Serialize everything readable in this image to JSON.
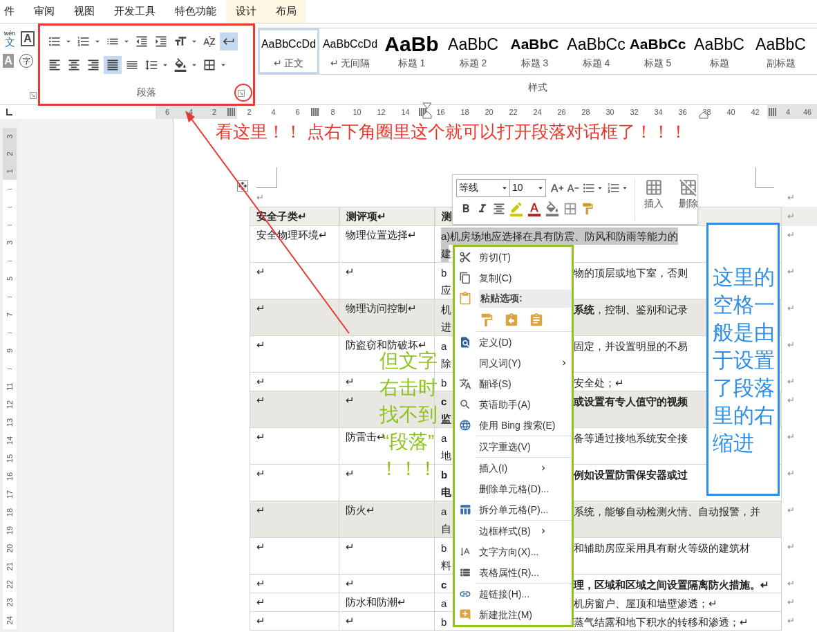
{
  "ribbon_tabs": [
    {
      "label": "件",
      "contextual": false
    },
    {
      "label": "审阅",
      "contextual": false
    },
    {
      "label": "视图",
      "contextual": false
    },
    {
      "label": "开发工具",
      "contextual": false
    },
    {
      "label": "特色功能",
      "contextual": false
    },
    {
      "label": "设计",
      "contextual": true
    },
    {
      "label": "布局",
      "contextual": true
    }
  ],
  "font_group": {
    "phonetic_top": "wén",
    "phonetic_char": "文",
    "border_char": "A",
    "shading_char": "A",
    "enclose_char": "字"
  },
  "paragraph_group": {
    "label": "段落",
    "row_1": [
      {
        "dropdown": true,
        "selected": false
      },
      {
        "dropdown": true,
        "selected": false
      },
      {
        "dropdown": true,
        "selected": false
      },
      {
        "dropdown": false,
        "selected": false
      },
      {
        "dropdown": false,
        "selected": false
      },
      {
        "dropdown": true,
        "selected": false
      },
      {
        "dropdown": false,
        "selected": false
      },
      {
        "dropdown": false,
        "selected": true
      }
    ],
    "row_2": [
      {
        "dropdown": false,
        "selected": false
      },
      {
        "dropdown": false,
        "selected": false
      },
      {
        "dropdown": false,
        "selected": false
      },
      {
        "dropdown": false,
        "selected": true
      },
      {
        "dropdown": false,
        "selected": false
      },
      {
        "dropdown": true,
        "selected": false
      },
      {
        "dropdown": true,
        "selected": false
      },
      {
        "dropdown": true,
        "selected": false
      }
    ]
  },
  "styles_group": {
    "label": "样式",
    "styles": [
      {
        "preview": "AaBbCcDd",
        "name": "↵ 正文",
        "kind": "small",
        "selected": true
      },
      {
        "preview": "AaBbCcDd",
        "name": "↵ 无间隔",
        "kind": "small",
        "selected": false
      },
      {
        "preview": "AaBb",
        "name": "标题 1",
        "kind": "large_bold",
        "selected": false
      },
      {
        "preview": "AaBbC",
        "name": "标题 2",
        "kind": "medium",
        "selected": false
      },
      {
        "preview": "AaBbC",
        "name": "标题 3",
        "kind": "medium_bold",
        "selected": false
      },
      {
        "preview": "AaBbCc",
        "name": "标题 4",
        "kind": "medium",
        "selected": false
      },
      {
        "preview": "AaBbCc",
        "name": "标题 5",
        "kind": "medium_bold",
        "selected": false
      },
      {
        "preview": "AaBbC",
        "name": "标题",
        "kind": "medium",
        "selected": false
      },
      {
        "preview": "AaBbC",
        "name": "副标题",
        "kind": "medium",
        "selected": false
      }
    ]
  },
  "horizontal_ruler": {
    "left_margin": [
      {
        "kind": "number",
        "text": "6"
      },
      {
        "kind": "number",
        "text": "4"
      },
      {
        "kind": "number",
        "text": "2"
      },
      {
        "kind": "column"
      }
    ],
    "body": [
      {
        "kind": "number",
        "text": "2"
      },
      {
        "kind": "number",
        "text": "4"
      },
      {
        "kind": "number",
        "text": "6"
      },
      {
        "kind": "column"
      },
      {
        "kind": "number",
        "text": "8"
      },
      {
        "kind": "number",
        "text": "10"
      },
      {
        "kind": "number",
        "text": "12"
      },
      {
        "kind": "number",
        "text": "14"
      },
      {
        "kind": "column"
      },
      {
        "kind": "number",
        "text": "16"
      },
      {
        "kind": "number",
        "text": "18"
      },
      {
        "kind": "number",
        "text": "20"
      },
      {
        "kind": "number",
        "text": "22"
      },
      {
        "kind": "number",
        "text": "24"
      },
      {
        "kind": "number",
        "text": "26"
      },
      {
        "kind": "number",
        "text": "28"
      },
      {
        "kind": "number",
        "text": "30"
      },
      {
        "kind": "number",
        "text": "32"
      },
      {
        "kind": "number",
        "text": "34"
      },
      {
        "kind": "number",
        "text": "36"
      },
      {
        "kind": "number",
        "text": "38"
      },
      {
        "kind": "number",
        "text": "40"
      },
      {
        "kind": "number",
        "text": "42"
      }
    ],
    "right_margin": [
      {
        "kind": "column"
      },
      {
        "kind": "number",
        "text": "4"
      },
      {
        "kind": "number",
        "text": "46"
      }
    ]
  },
  "vertical_ruler": {
    "top": [
      {
        "kind": "number",
        "text": "3"
      },
      {
        "kind": "number",
        "text": "2"
      },
      {
        "kind": "number",
        "text": "1"
      }
    ],
    "body": [
      {
        "kind": "tick"
      },
      {
        "kind": "tick"
      },
      {
        "kind": "tick"
      },
      {
        "kind": "number",
        "text": "3"
      },
      {
        "kind": "tick"
      },
      {
        "kind": "number",
        "text": "5"
      },
      {
        "kind": "tick"
      },
      {
        "kind": "number",
        "text": "7"
      },
      {
        "kind": "tick"
      },
      {
        "kind": "number",
        "text": "9"
      },
      {
        "kind": "tick"
      },
      {
        "kind": "number",
        "text": "11"
      },
      {
        "kind": "number",
        "text": "12"
      },
      {
        "kind": "number",
        "text": "13"
      },
      {
        "kind": "number",
        "text": "14"
      },
      {
        "kind": "number",
        "text": "15"
      },
      {
        "kind": "number",
        "text": "16"
      },
      {
        "kind": "number",
        "text": "17"
      },
      {
        "kind": "number",
        "text": "18"
      },
      {
        "kind": "number",
        "text": "19"
      },
      {
        "kind": "number",
        "text": "20"
      },
      {
        "kind": "number",
        "text": "21"
      },
      {
        "kind": "number",
        "text": "22"
      },
      {
        "kind": "number",
        "text": "23"
      },
      {
        "kind": "number",
        "text": "24"
      }
    ]
  },
  "document": {
    "top_marks": [
      "↵",
      "↵"
    ],
    "table": {
      "header": [
        "安全子类↵",
        "测评项↵",
        "测"
      ],
      "header_end": "↵",
      "rows": [
        {
          "col_1": "安全物理环境↵",
          "col_2": "物理位置选择↵",
          "col_3": {
            "left": "a)机房场地应选择在具有防震、防风和防雨等能力的",
            "line_2": "建",
            "selected": true,
            "bold": false
          },
          "shaded": false,
          "end": "↵"
        },
        {
          "col_1": "↵",
          "col_2": "↵",
          "col_3": {
            "left": "b",
            "right": "物的顶层或地下室，否则",
            "line_2": "应",
            "selected": false,
            "bold": false
          },
          "shaded": false,
          "end": "↵"
        },
        {
          "col_1": "↵",
          "col_2": "物理访问控制↵",
          "col_3": {
            "left": "机",
            "right": "**系统**，控制、鉴别和记录",
            "line_2": "进",
            "selected": false,
            "bold": false
          },
          "shaded": true,
          "end": "↵"
        },
        {
          "col_1": "↵",
          "col_2": "防盗窃和防破坏↵",
          "col_3": {
            "left": "a",
            "right": "固定，并设置明显的不易",
            "line_2": "除",
            "selected": false,
            "bold": false
          },
          "shaded": false,
          "end": "↵"
        },
        {
          "col_1": "↵",
          "col_2": "↵",
          "col_3": {
            "left": "b",
            "right": "安全处；↵",
            "selected": false,
            "bold": false
          },
          "shaded": false,
          "end": "↵"
        },
        {
          "col_1": "↵",
          "col_2": "↵",
          "col_3": {
            "left": "c",
            "right": "或设置有专人值守的视频",
            "line_2": "监",
            "selected": false,
            "bold": true
          },
          "shaded": true,
          "end": "↵"
        },
        {
          "col_1": "↵",
          "col_2": "防雷击↵",
          "col_3": {
            "left": "a",
            "right": "备等通过接地系统安全接",
            "line_2": "地",
            "selected": false,
            "bold": false
          },
          "shaded": false,
          "end": "↵"
        },
        {
          "col_1": "↵",
          "col_2": "↵",
          "col_3": {
            "left": "b",
            "right": "例如设置防雷保安器或过",
            "line_2": "电",
            "selected": false,
            "bold": true
          },
          "shaded": false,
          "end": "↵"
        },
        {
          "col_1": "↵",
          "col_2": "防火↵",
          "col_3": {
            "left": "a",
            "right": "系统，能够自动检测火情、自动报警，并",
            "line_2": "自",
            "selected": false,
            "bold": false
          },
          "shaded": true,
          "end": "↵"
        },
        {
          "col_1": "↵",
          "col_2": "↵",
          "col_3": {
            "left": "b",
            "right": "和辅助房应采用具有耐火等级的建筑材",
            "line_2": "料",
            "selected": false,
            "bold": false
          },
          "shaded": false,
          "end": "↵"
        },
        {
          "col_1": "↵",
          "col_2": "↵",
          "col_3": {
            "left": "c",
            "right": "理，区域和区域之间设置隔离防火措施。↵",
            "selected": false,
            "bold": true
          },
          "shaded": false,
          "end": "↵"
        },
        {
          "col_1": "↵",
          "col_2": "防水和防潮↵",
          "col_3": {
            "left": "a",
            "right": "机房窗户、屋顶和墙壁渗透；↵",
            "selected": false,
            "bold": false
          },
          "shaded": false,
          "end": "↵"
        },
        {
          "col_1": "↵",
          "col_2": "↵",
          "col_3": {
            "left": "b",
            "right": "蒸气结露和地下积水的转移和渗透；↵",
            "selected": false,
            "bold": false
          },
          "shaded": false,
          "end": "↵"
        }
      ]
    }
  },
  "mini_toolbar": {
    "font": "等线",
    "size": "10",
    "insert_label": "插入",
    "delete_label": "删除"
  },
  "context_menu": {
    "items": [
      {
        "kind": "item",
        "label": "剪切(T)",
        "submenu": false
      },
      {
        "kind": "item",
        "label": "复制(C)",
        "submenu": false
      },
      {
        "kind": "header",
        "label": "粘贴选项:"
      },
      {
        "kind": "paste_options"
      },
      {
        "kind": "item",
        "label": "定义(D)",
        "submenu": false,
        "separator": true
      },
      {
        "kind": "item",
        "label": "同义词(Y)",
        "submenu": true
      },
      {
        "kind": "item",
        "label": "翻译(S)",
        "submenu": false
      },
      {
        "kind": "item",
        "label": "英语助手(A)",
        "submenu": false
      },
      {
        "kind": "item",
        "label": "使用 Bing 搜索(E)",
        "submenu": false
      },
      {
        "kind": "item",
        "label": "汉字重选(V)",
        "submenu": false,
        "separator": true
      },
      {
        "kind": "item",
        "label": "插入(I)",
        "submenu": true,
        "separator": true
      },
      {
        "kind": "item",
        "label": "删除单元格(D)...",
        "submenu": false
      },
      {
        "kind": "item",
        "label": "拆分单元格(P)...",
        "submenu": false
      },
      {
        "kind": "item",
        "label": "边框样式(B)",
        "submenu": true,
        "separator": true
      },
      {
        "kind": "item",
        "label": "文字方向(X)...",
        "submenu": false
      },
      {
        "kind": "item",
        "label": "表格属性(R)...",
        "submenu": false
      },
      {
        "kind": "item",
        "label": "超链接(H)...",
        "submenu": false,
        "separator": true
      },
      {
        "kind": "item",
        "label": "新建批注(M)",
        "submenu": false
      }
    ]
  },
  "annotations": {
    "callout": "看这里！！ 点右下角圈里这个就可以打开段落对话框了！！！",
    "left_note": [
      "但文字",
      "右击时",
      "找不到",
      "“段落”",
      "！！！"
    ],
    "right_note": "这里的空格一般是由于设置了段落里的右缩进"
  }
}
